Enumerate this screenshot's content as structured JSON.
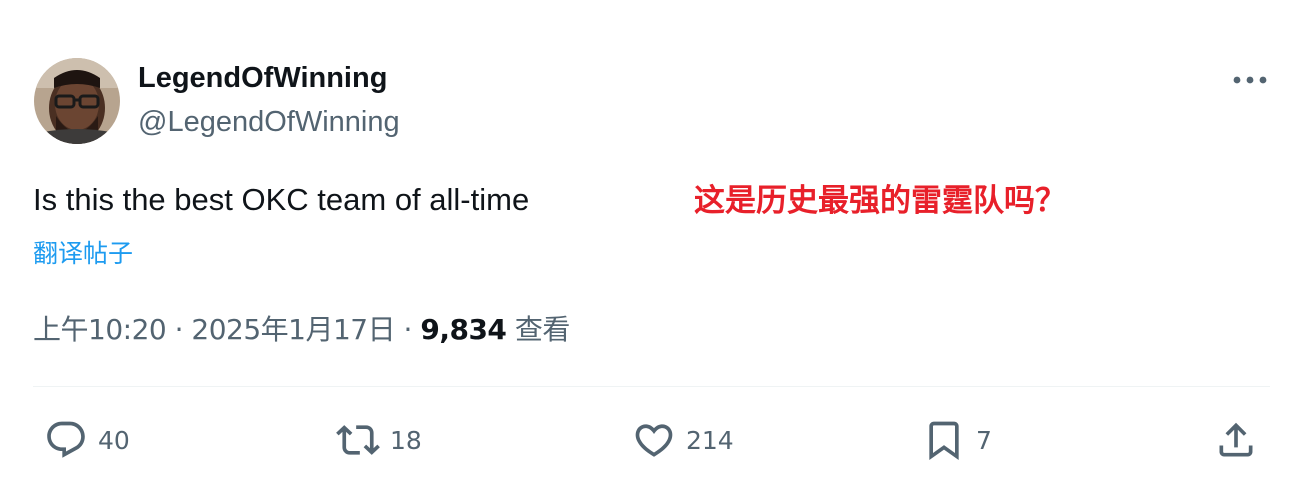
{
  "author": {
    "display_name": "LegendOfWinning",
    "handle": "@LegendOfWinning",
    "avatar_icon": "user-avatar-photo"
  },
  "tweet": {
    "text": "Is this the best OKC team of all-time",
    "annotation": "这是历史最强的雷霆队吗？",
    "translate_label": "翻译帖子"
  },
  "meta": {
    "time": "上午10:20",
    "separator": "·",
    "date": "2025年1月17日",
    "views_count": "9,834",
    "views_label": "查看"
  },
  "actions": {
    "reply_count": "40",
    "retweet_count": "18",
    "like_count": "214",
    "bookmark_count": "7"
  },
  "colors": {
    "accent": "#1d9bf0",
    "annotation": "#e8202a",
    "secondary_text": "#536471",
    "primary_text": "#0f1419"
  },
  "icons": [
    "more-icon",
    "reply-icon",
    "retweet-icon",
    "like-icon",
    "bookmark-icon",
    "share-icon"
  ]
}
